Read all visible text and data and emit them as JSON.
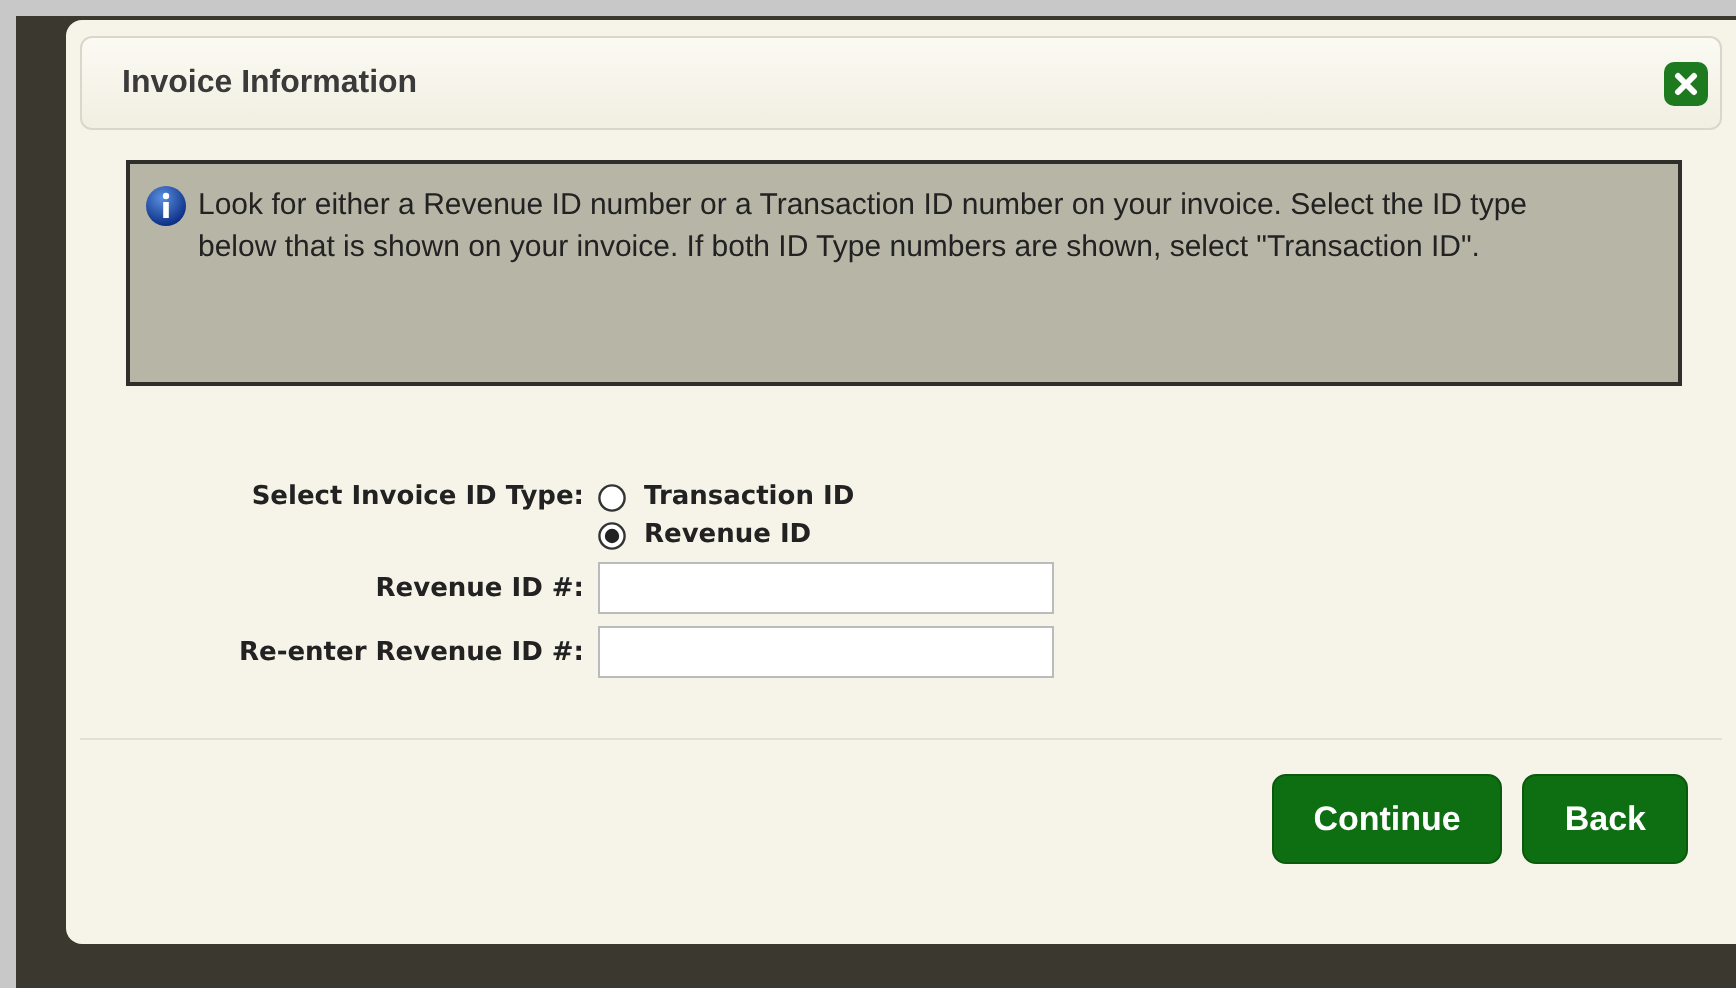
{
  "dialog": {
    "title": "Invoice Information",
    "info": "Look for either a Revenue ID number or a Transaction ID number on your invoice. Select the ID type below that is shown on your invoice. If both ID Type numbers are shown, select \"Transaction ID\".",
    "id_type": {
      "label": "Select Invoice ID Type:",
      "options": [
        {
          "label": "Transaction ID",
          "selected": false
        },
        {
          "label": "Revenue ID",
          "selected": true
        }
      ]
    },
    "fields": [
      {
        "label": "Revenue ID #:"
      },
      {
        "label": "Re-enter Revenue ID #:"
      }
    ],
    "buttons": [
      "Continue",
      "Back"
    ]
  }
}
